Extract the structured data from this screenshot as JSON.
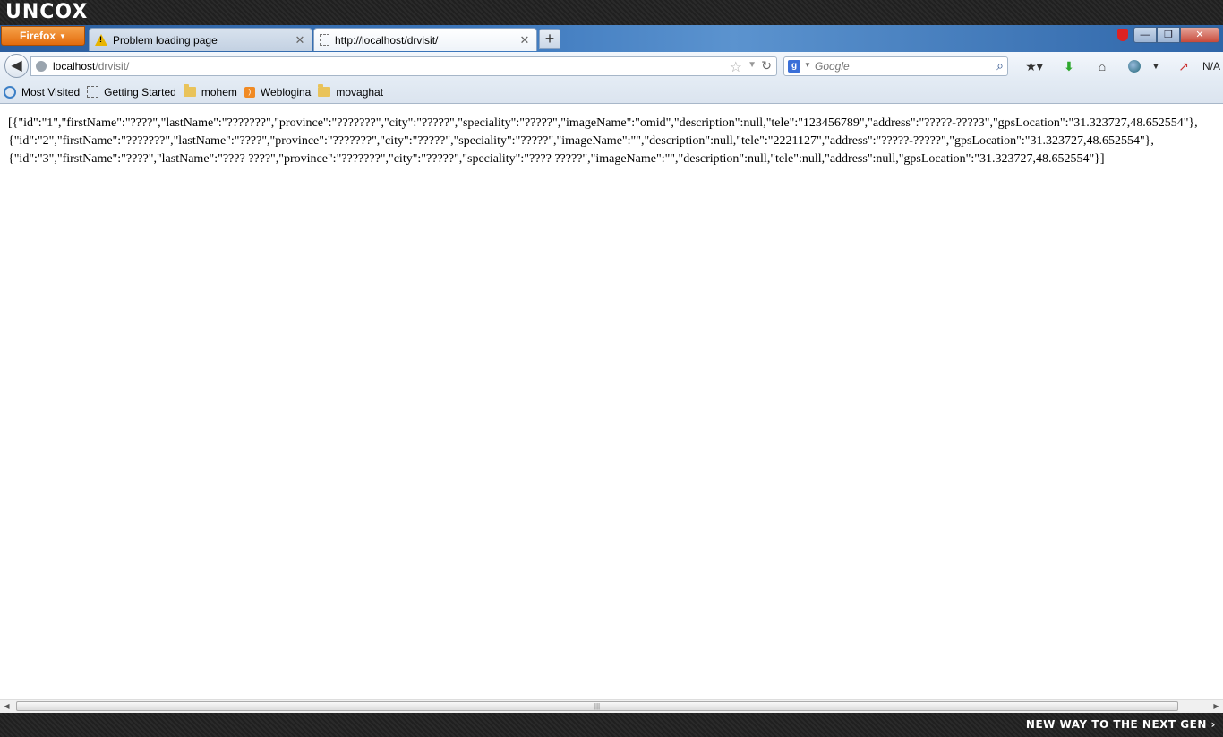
{
  "os": {
    "logo": "UNCOX",
    "tagline": "NEW WAY TO THE NEXT GEN ›"
  },
  "browser": {
    "menu_button": "Firefox",
    "tabs": [
      {
        "title": "Problem loading page",
        "icon": "warning-icon",
        "active": false
      },
      {
        "title": "http://localhost/drvisit/",
        "icon": "blank-page-icon",
        "active": true
      }
    ],
    "new_tab_label": "+",
    "window_controls": {
      "minimize": "—",
      "maximize": "❐",
      "close": "✕"
    }
  },
  "navbar": {
    "url_host": "localhost",
    "url_path": "/drvisit/",
    "search_placeholder": "Google",
    "addon_label": "N/A"
  },
  "bookmarks": [
    {
      "label": "Most Visited",
      "icon": "most-visited-icon"
    },
    {
      "label": "Getting Started",
      "icon": "dashed-page-icon"
    },
    {
      "label": "mohem",
      "icon": "folder-icon"
    },
    {
      "label": "Weblogina",
      "icon": "rss-icon"
    },
    {
      "label": "movaghat",
      "icon": "folder-icon"
    }
  ],
  "content": {
    "lines": [
      "[{\"id\":\"1\",\"firstName\":\"????\",\"lastName\":\"???????\",\"province\":\"???????\",\"city\":\"?????\",\"speciality\":\"?????\",\"imageName\":\"omid\",\"description\":null,\"tele\":\"123456789\",\"address\":\"?????-????3\",\"gpsLocation\":\"31.323727,48.652554\"},",
      "{\"id\":\"2\",\"firstName\":\"???????\",\"lastName\":\"????\",\"province\":\"???????\",\"city\":\"?????\",\"speciality\":\"?????\",\"imageName\":\"\",\"description\":null,\"tele\":\"2221127\",\"address\":\"?????-?????\",\"gpsLocation\":\"31.323727,48.652554\"},",
      "{\"id\":\"3\",\"firstName\":\"????\",\"lastName\":\"???? ????\",\"province\":\"???????\",\"city\":\"?????\",\"speciality\":\"???? ?????\",\"imageName\":\"\",\"description\":null,\"tele\":null,\"address\":null,\"gpsLocation\":\"31.323727,48.652554\"}]"
    ]
  }
}
